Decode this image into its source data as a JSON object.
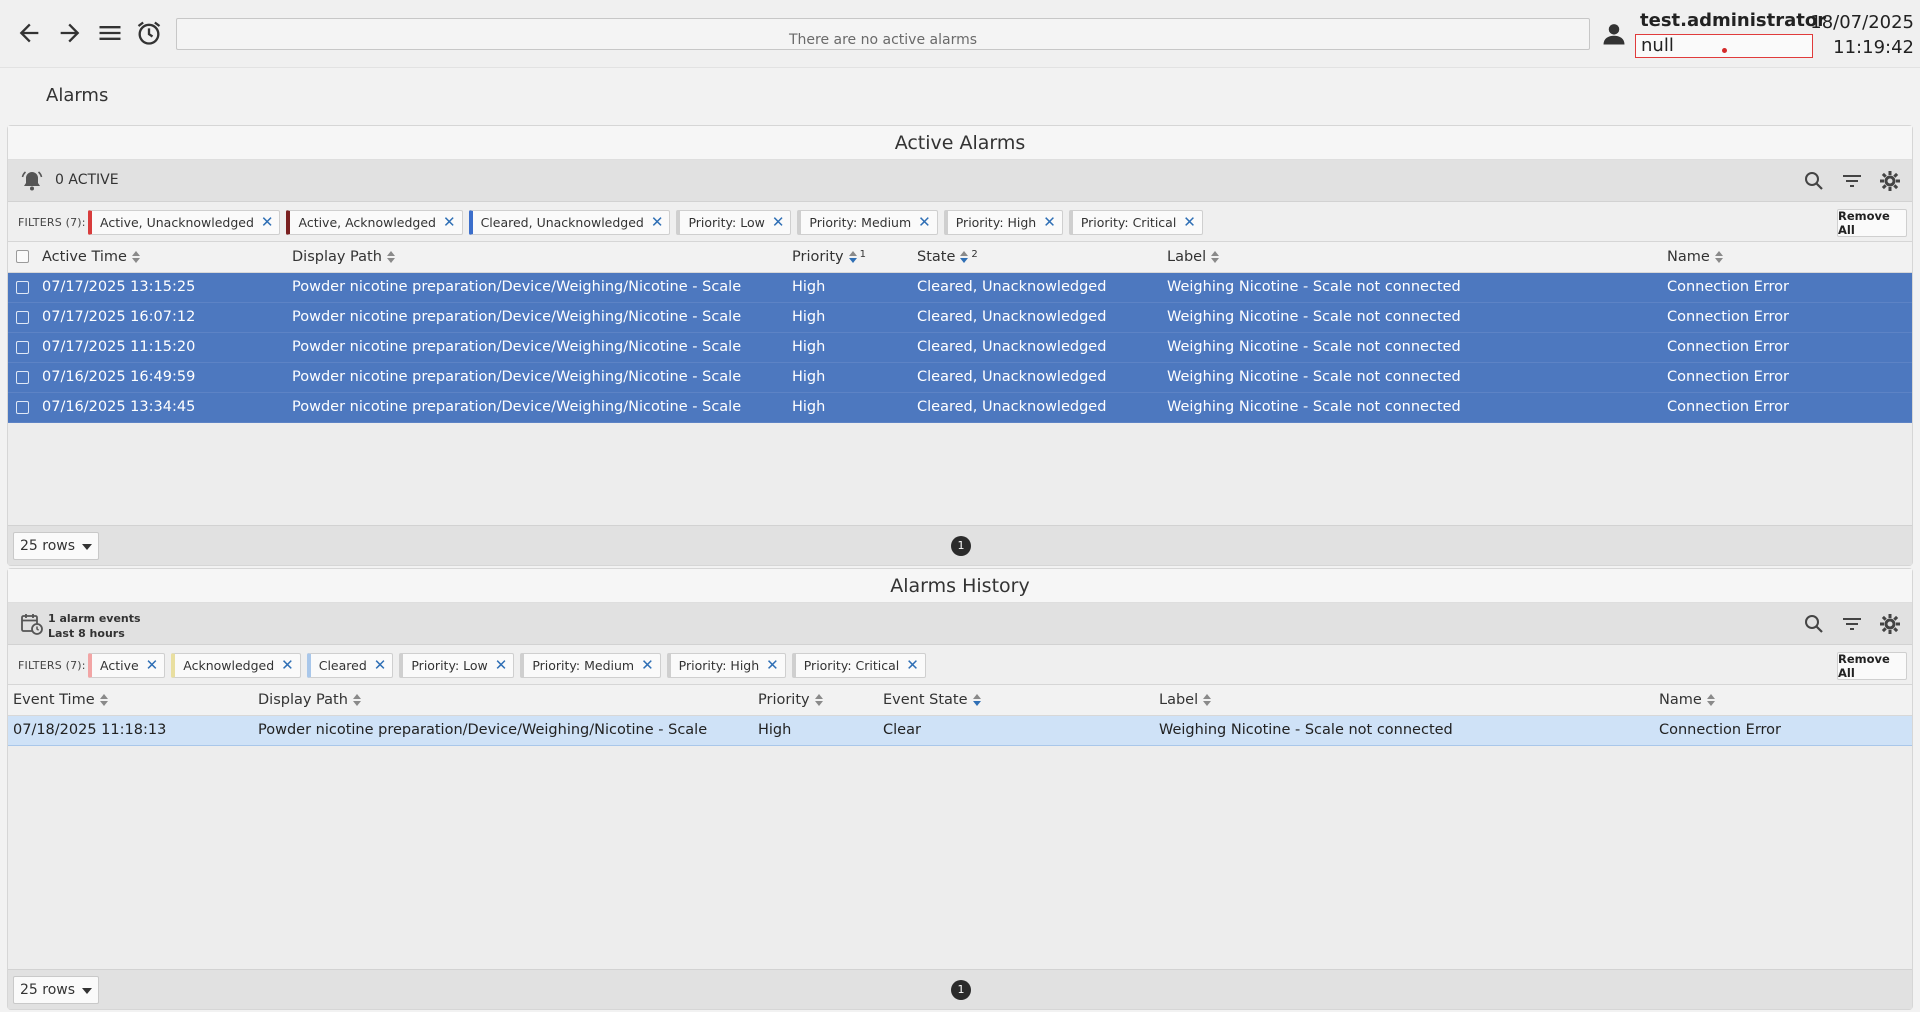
{
  "header": {
    "alarm_banner": "There are no active alarms",
    "username": "test.administrator",
    "user_field": "null",
    "date": "18/07/2025",
    "time": "11:19:42"
  },
  "page": {
    "title": "Alarms"
  },
  "active_alarms": {
    "title": "Active Alarms",
    "count_label": "0 ACTIVE",
    "filters_label": "FILTERS (7):",
    "filters": [
      {
        "label": "Active, Unacknowledged",
        "color": "#d83c3c"
      },
      {
        "label": "Active, Acknowledged",
        "color": "#7a2020"
      },
      {
        "label": "Cleared, Unacknowledged",
        "color": "#3b6ecb"
      },
      {
        "label": "Priority: Low",
        "color": "#cfcfcf"
      },
      {
        "label": "Priority: Medium",
        "color": "#cfcfcf"
      },
      {
        "label": "Priority: High",
        "color": "#cfcfcf"
      },
      {
        "label": "Priority: Critical",
        "color": "#cfcfcf"
      }
    ],
    "remove_all": "Remove All",
    "columns": {
      "active_time": "Active Time",
      "display_path": "Display Path",
      "priority": "Priority",
      "priority_sort_index": "1",
      "state": "State",
      "state_sort_index": "2",
      "label": "Label",
      "name": "Name"
    },
    "rows": [
      {
        "time": "07/17/2025 13:15:25",
        "path": "Powder nicotine preparation/Device/Weighing/Nicotine - Scale",
        "priority": "High",
        "state": "Cleared, Unacknowledged",
        "label": "Weighing Nicotine - Scale not connected",
        "name": "Connection Error"
      },
      {
        "time": "07/17/2025 16:07:12",
        "path": "Powder nicotine preparation/Device/Weighing/Nicotine - Scale",
        "priority": "High",
        "state": "Cleared, Unacknowledged",
        "label": "Weighing Nicotine - Scale not connected",
        "name": "Connection Error"
      },
      {
        "time": "07/17/2025 11:15:20",
        "path": "Powder nicotine preparation/Device/Weighing/Nicotine - Scale",
        "priority": "High",
        "state": "Cleared, Unacknowledged",
        "label": "Weighing Nicotine - Scale not connected",
        "name": "Connection Error"
      },
      {
        "time": "07/16/2025 16:49:59",
        "path": "Powder nicotine preparation/Device/Weighing/Nicotine - Scale",
        "priority": "High",
        "state": "Cleared, Unacknowledged",
        "label": "Weighing Nicotine - Scale not connected",
        "name": "Connection Error"
      },
      {
        "time": "07/16/2025 13:34:45",
        "path": "Powder nicotine preparation/Device/Weighing/Nicotine - Scale",
        "priority": "High",
        "state": "Cleared, Unacknowledged",
        "label": "Weighing Nicotine - Scale not connected",
        "name": "Connection Error"
      }
    ],
    "rows_per_page": "25 rows",
    "page": "1"
  },
  "alarms_history": {
    "title": "Alarms History",
    "events_label": "1 alarm events",
    "range_label": "Last 8 hours",
    "filters_label": "FILTERS (7):",
    "filters": [
      {
        "label": "Active",
        "color": "#f2a5a5"
      },
      {
        "label": "Acknowledged",
        "color": "#e9dfa0"
      },
      {
        "label": "Cleared",
        "color": "#a9c7ea"
      },
      {
        "label": "Priority: Low",
        "color": "#cfcfcf"
      },
      {
        "label": "Priority: Medium",
        "color": "#cfcfcf"
      },
      {
        "label": "Priority: High",
        "color": "#cfcfcf"
      },
      {
        "label": "Priority: Critical",
        "color": "#cfcfcf"
      }
    ],
    "remove_all": "Remove All",
    "columns": {
      "event_time": "Event Time",
      "display_path": "Display Path",
      "priority": "Priority",
      "event_state": "Event State",
      "label": "Label",
      "name": "Name"
    },
    "rows": [
      {
        "time": "07/18/2025 11:18:13",
        "path": "Powder nicotine preparation/Device/Weighing/Nicotine - Scale",
        "priority": "High",
        "state": "Clear",
        "label": "Weighing Nicotine - Scale not connected",
        "name": "Connection Error"
      }
    ],
    "rows_per_page": "25 rows",
    "page": "1"
  }
}
